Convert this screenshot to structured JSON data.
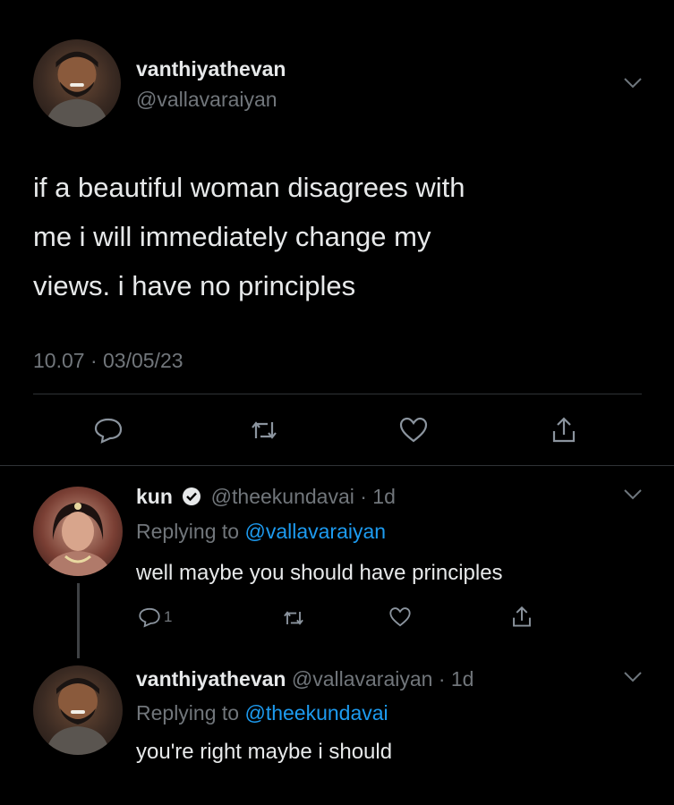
{
  "main_tweet": {
    "display_name": "vanthiyathevan",
    "handle": "@vallavaraiyan",
    "text_lines": [
      "if a beautiful woman disagrees with",
      "me i will immediately change my",
      "views. i have no principles"
    ],
    "timestamp": "10.07 · 03/05/23"
  },
  "replies": [
    {
      "display_name": "kun",
      "verified": true,
      "handle": "@theekundavai",
      "time": "· 1d",
      "replying_prefix": "Replying to ",
      "replying_to": "@vallavaraiyan",
      "text": "well maybe you should have principles",
      "reply_count": "1"
    },
    {
      "display_name": "vanthiyathevan",
      "handle": "@vallavaraiyan",
      "time": "· 1d",
      "replying_prefix": "Replying to ",
      "replying_to": "@theekundavai",
      "text": "you're right maybe i should"
    }
  ],
  "colors": {
    "background": "#000000",
    "text": "#e7e9ea",
    "muted": "#71767b",
    "link": "#1d9bf0",
    "divider": "#2f3336"
  },
  "icons": [
    "chevron-down-icon",
    "reply-icon",
    "retweet-icon",
    "like-icon",
    "share-icon",
    "verified-badge-icon"
  ]
}
